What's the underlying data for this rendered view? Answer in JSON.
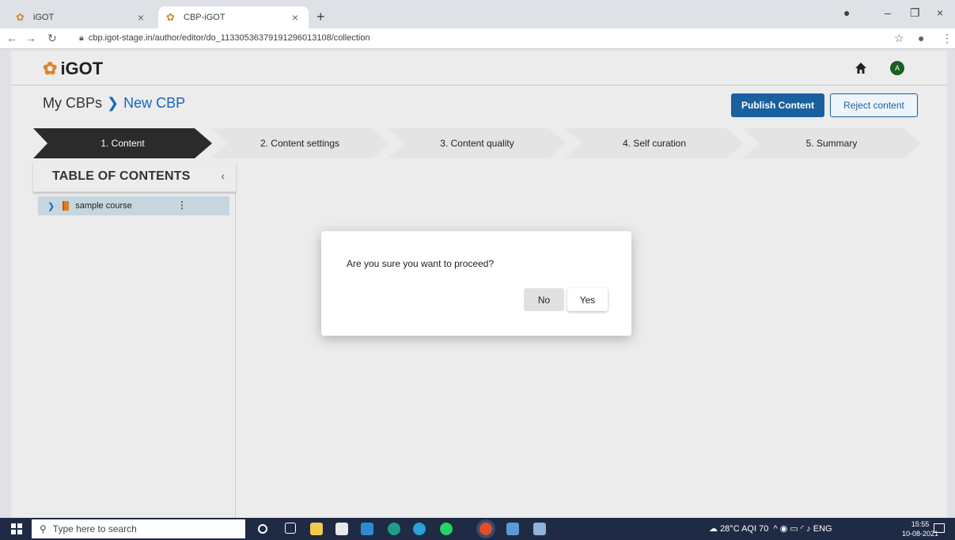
{
  "browser": {
    "tabs": [
      {
        "title": "iGOT",
        "active": false
      },
      {
        "title": "CBP-iGOT",
        "active": true
      }
    ],
    "url": "cbp.igot-stage.in/author/editor/do_113305363791912960131​08/collection"
  },
  "header": {
    "logo_text": "iGOT",
    "avatar_initial": "A"
  },
  "breadcrumb": {
    "root": "My CBPs",
    "current": "New CBP"
  },
  "actions": {
    "publish_label": "Publish Content",
    "reject_label": "Reject content"
  },
  "steps": [
    {
      "label": "1. Content",
      "active": true
    },
    {
      "label": "2. Content settings",
      "active": false
    },
    {
      "label": "3. Content quality",
      "active": false
    },
    {
      "label": "4. Self curation",
      "active": false
    },
    {
      "label": "5. Summary",
      "active": false
    }
  ],
  "toc": {
    "title": "TABLE OF CONTENTS",
    "items": [
      {
        "label": "sample course"
      }
    ]
  },
  "dialog": {
    "message": "Are you sure you want to proceed?",
    "no_label": "No",
    "yes_label": "Yes"
  },
  "taskbar": {
    "search_placeholder": "Type here to search",
    "weather": "28°C  AQI 70",
    "lang": "ENG",
    "time": "15:55",
    "date": "10-08-2021"
  },
  "colors": {
    "accent": "#1a5f9e",
    "active_step": "#2b2b2b",
    "brand_orange": "#d9892b"
  }
}
